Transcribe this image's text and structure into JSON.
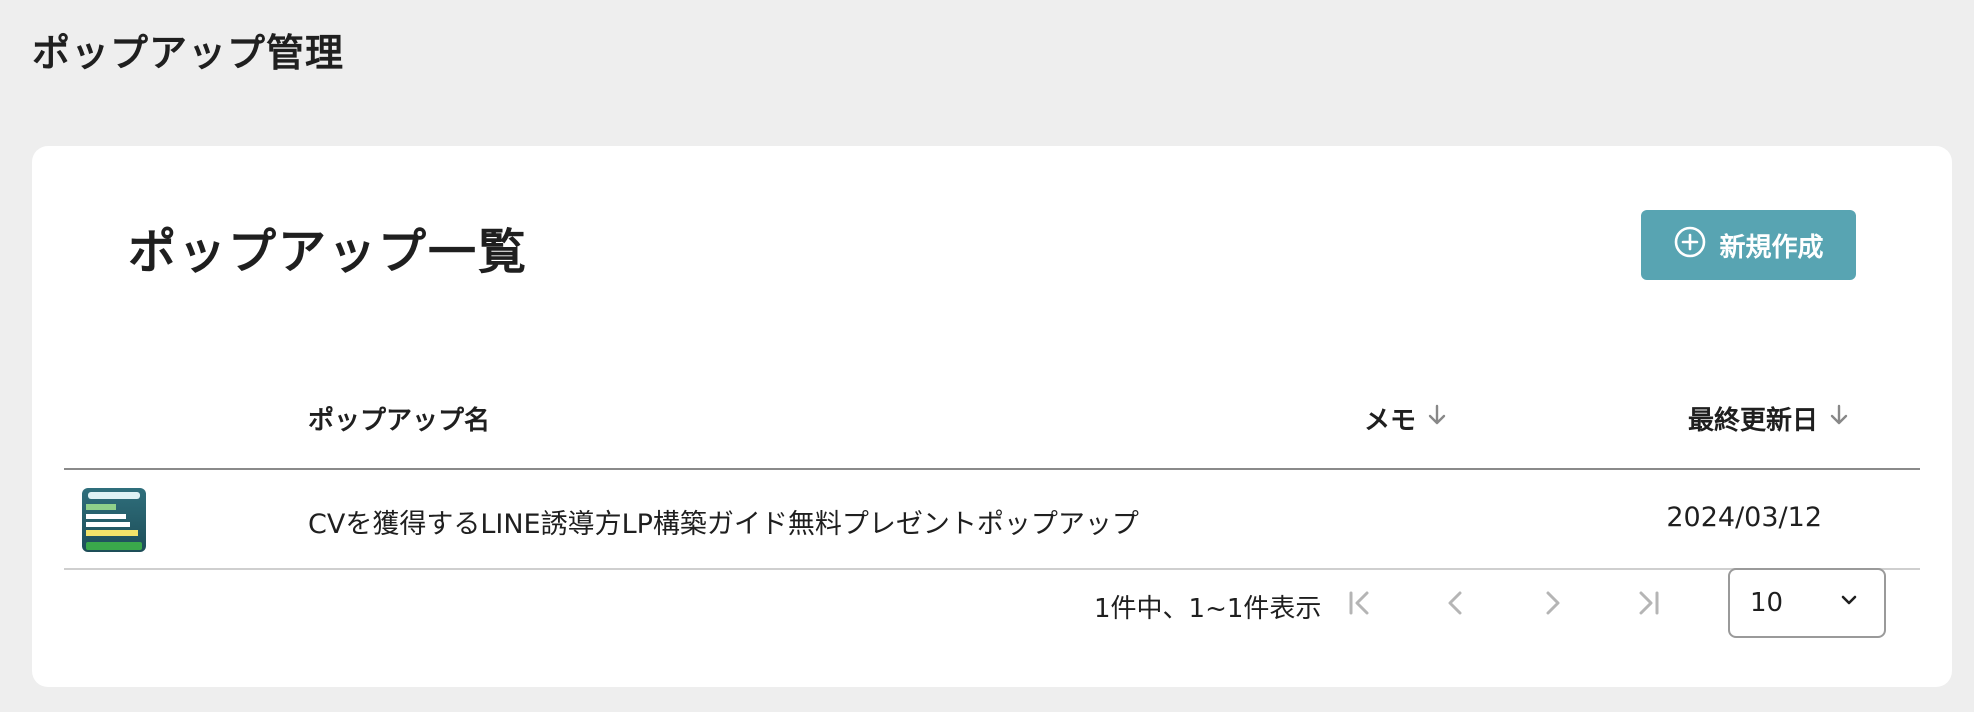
{
  "header": {
    "title": "ポップアップ管理"
  },
  "card": {
    "title": "ポップアップ一覧",
    "create_button_label": "新規作成"
  },
  "table": {
    "columns": {
      "name": "ポップアップ名",
      "memo": "メモ",
      "updated": "最終更新日"
    },
    "rows": [
      {
        "name": "CVを獲得するLINE誘導方LP構築ガイド無料プレゼントポップアップ",
        "memo": "",
        "updated": "2024/03/12"
      }
    ]
  },
  "pagination": {
    "summary": "1件中、1~1件表示",
    "per_page": "10"
  },
  "colors": {
    "accent": "#58a4b2",
    "background": "#eeeeee",
    "card": "#ffffff"
  },
  "icons": [
    "plus-circle-icon",
    "arrow-down-icon",
    "first-page-icon",
    "chevron-left-icon",
    "chevron-right-icon",
    "last-page-icon",
    "chevron-down-icon"
  ]
}
